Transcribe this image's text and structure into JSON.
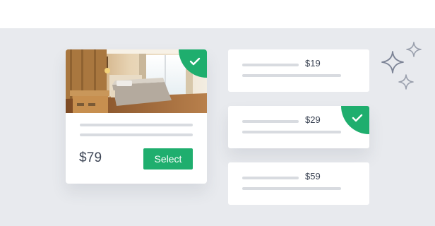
{
  "main_card": {
    "photo_alt": "bedroom-photo",
    "price": "$79",
    "select_label": "Select",
    "selected": true
  },
  "options": [
    {
      "price": "$19",
      "selected": false
    },
    {
      "price": "$29",
      "selected": true
    },
    {
      "price": "$59",
      "selected": false
    }
  ],
  "colors": {
    "accent_green": "#1fae6e",
    "background": "#e8eaee",
    "text": "#3d4555",
    "placeholder_line": "#d8dbe0",
    "sparkle": "#7d8496"
  },
  "icons": [
    "check-icon",
    "sparkle-icon"
  ]
}
